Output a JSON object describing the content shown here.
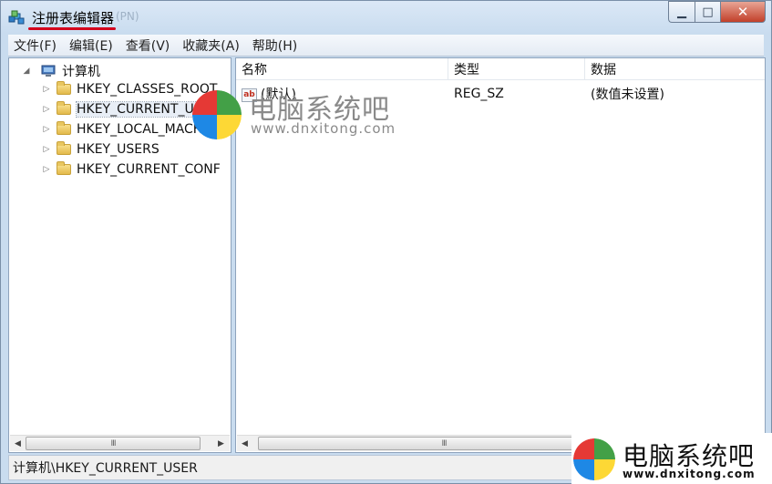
{
  "window": {
    "title": "注册表编辑器",
    "title_ghost": "(PN)",
    "controls": {
      "minimize": "▁",
      "maximize": "□",
      "close": "✕"
    }
  },
  "menu": [
    "文件(F)",
    "编辑(E)",
    "查看(V)",
    "收藏夹(A)",
    "帮助(H)"
  ],
  "tree": {
    "root_label": "计算机",
    "items": [
      {
        "label": "HKEY_CLASSES_ROOT"
      },
      {
        "label": "HKEY_CURRENT_USER",
        "selected": true
      },
      {
        "label": "HKEY_LOCAL_MACHIN"
      },
      {
        "label": "HKEY_USERS"
      },
      {
        "label": "HKEY_CURRENT_CONF"
      }
    ]
  },
  "list": {
    "columns": [
      "名称",
      "类型",
      "数据"
    ],
    "rows": [
      {
        "name": "(默认)",
        "type": "REG_SZ",
        "data": "(数值未设置)"
      }
    ]
  },
  "statusbar": {
    "path": "计算机\\HKEY_CURRENT_USER"
  },
  "watermark": {
    "title": "电脑系统吧",
    "url": "www.dnxitong.com"
  },
  "badge": {
    "title": "电脑系统吧",
    "url": "www.dnxitong.com"
  },
  "colors": {
    "frame": "#c9dcef",
    "title_underline": "#d4001c",
    "close_button": "#c2402a",
    "logo_red": "#e53935",
    "logo_green": "#43a047",
    "logo_blue": "#1e88e5",
    "logo_yellow": "#fdd835"
  },
  "scrollbars": {
    "thumb_grip": "III"
  }
}
